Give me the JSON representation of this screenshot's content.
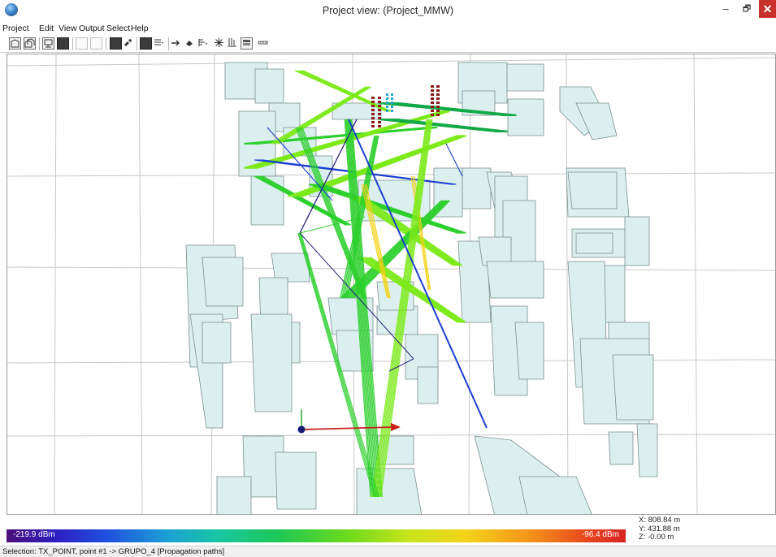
{
  "window": {
    "title": "Project view: (Project_MMW)",
    "minimize_glyph": "–",
    "restore_glyph": "🗗",
    "close_glyph": "✕"
  },
  "menu": {
    "items": [
      "Project",
      "Edit",
      "View",
      "Output",
      "Select",
      "Help"
    ]
  },
  "toolbar": {
    "icons": [
      "open-project-icon",
      "copy-project-icon",
      "monitor-icon",
      "solid-view-icon",
      "wire-box-icon",
      "wire-box-2-icon",
      "layers-dropdown-icon",
      "tools-icon",
      "shaded-view-icon",
      "menu-dropdown-icon",
      "arrow-right-icon",
      "point-icon",
      "bars-dropdown-icon",
      "star-icon",
      "antenna-icon",
      "stack-icon",
      "ruler-icon"
    ]
  },
  "legend": {
    "min_label": "-219.9 dBm",
    "max_label": "-96.4 dBm",
    "colors": [
      "#4b0f7a",
      "#2d1ec2",
      "#1f4fe0",
      "#1ca0d4",
      "#18c6a4",
      "#1ec856",
      "#6cda1d",
      "#c8e41a",
      "#f3d419",
      "#f49719",
      "#ea4b1d",
      "#d82323"
    ]
  },
  "coords": {
    "x": "X: 808.84 m",
    "y": "Y: 431.88 m",
    "z": "Z: -0.00 m"
  },
  "status": {
    "text": "Selection: TX_POINT, point #1 -> GRUPO_4 [Propagation paths]"
  },
  "colors": {
    "building_fill": "#dcefef",
    "building_stroke": "#7a8f8f",
    "road_line": "#c8c8c8",
    "path_green": "#2bcf2b",
    "path_lime": "#7cea1a",
    "path_dark_green": "#14a848",
    "path_blue": "#1b3fd1",
    "path_navy": "#24217a",
    "path_yellow": "#f2d315",
    "tx_dot": "#141a78",
    "axis_x": "#c8201b",
    "axis_y": "#27a82f",
    "rx_marker": "#8c1616",
    "rx_marker_cyan": "#20a6d2"
  }
}
